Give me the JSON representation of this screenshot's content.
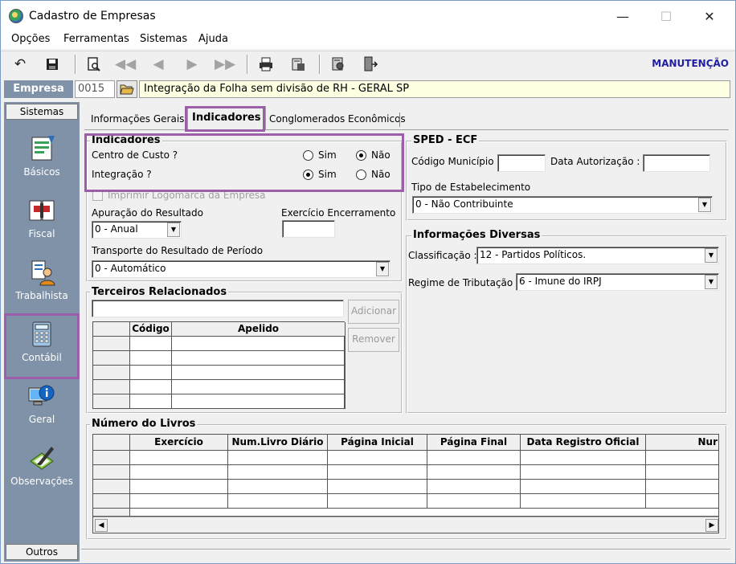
{
  "window": {
    "title": "Cadastro de Empresas",
    "minimize": "—",
    "maximize": "☐",
    "close": "✕"
  },
  "menu": [
    "Opções",
    "Ferramentas",
    "Sistemas",
    "Ajuda"
  ],
  "toolbar": {
    "mode_label": "MANUTENÇÃO",
    "icons": [
      "undo-icon",
      "save-icon",
      "print-preview-icon",
      "first-record-icon",
      "previous-record-icon",
      "next-record-icon",
      "last-record-icon",
      "printer-icon",
      "report-icon",
      "config-icon",
      "exit-icon"
    ]
  },
  "empresa": {
    "label": "Empresa",
    "code": "0015",
    "name": "Integração da Folha  sem divisão de RH - GERAL SP"
  },
  "sidebar": {
    "top_label": "Sistemas",
    "bottom_label": "Outros",
    "items": [
      {
        "label": "Básicos",
        "icon": "basicos-icon"
      },
      {
        "label": "Fiscal",
        "icon": "fiscal-icon"
      },
      {
        "label": "Trabalhista",
        "icon": "trabalhista-icon"
      },
      {
        "label": "Contábil",
        "icon": "contabil-icon"
      },
      {
        "label": "Geral",
        "icon": "geral-icon"
      },
      {
        "label": "Observações",
        "icon": "observacoes-icon"
      }
    ],
    "selected": "Contábil"
  },
  "tabs": [
    "Informações Gerais",
    "Indicadores",
    "Conglomerados Econômicos"
  ],
  "active_tab": "Indicadores",
  "indicadores": {
    "title": "Indicadores",
    "centro_custo": {
      "label": "Centro de Custo ?",
      "sim": "Sim",
      "nao": "Não",
      "value": "Não"
    },
    "integracao": {
      "label": "Integração ?",
      "sim": "Sim",
      "nao": "Não",
      "value": "Sim"
    },
    "imprimir_logo": "Imprimir Logomarca da Empresa",
    "apuracao": {
      "label": "Apuração do Resultado",
      "value": "0 - Anual"
    },
    "exercicio_encerramento": {
      "label": "Exercício Encerramento",
      "value": ""
    },
    "transporte": {
      "label": "Transporte do Resultado de Período",
      "value": "0 - Automático"
    }
  },
  "terceiros": {
    "title": "Terceiros Relacionados",
    "input_value": "",
    "add_label": "Adicionar",
    "remove_label": "Remover",
    "columns": [
      "Código",
      "Apelido"
    ]
  },
  "sped": {
    "title": "SPED - ECF",
    "codigo_municipio": {
      "label": "Código Município :",
      "value": ""
    },
    "data_autorizacao": {
      "label": "Data Autorização :",
      "value": ""
    },
    "tipo_estabelecimento": {
      "label": "Tipo de Estabelecimento",
      "value": "0 - Não Contribuinte"
    }
  },
  "info_diversas": {
    "title": "Informações Diversas",
    "classificacao": {
      "label": "Classificação :",
      "value": "12 - Partidos Políticos."
    },
    "regime": {
      "label": "Regime de Tributação :",
      "value": "6 - Imune do IRPJ"
    }
  },
  "livros": {
    "title": "Número do Livros",
    "columns": [
      "Exercício",
      "Num.Livro Diário",
      "Página Inicial",
      "Página Final",
      "Data Registro Oficial",
      "Nur"
    ]
  },
  "colors": {
    "sidebar": "#7f92a8",
    "highlight": "#9b5ea8",
    "empresa_name_bg": "#ffffe1",
    "mode_label": "#1f1f9f"
  }
}
